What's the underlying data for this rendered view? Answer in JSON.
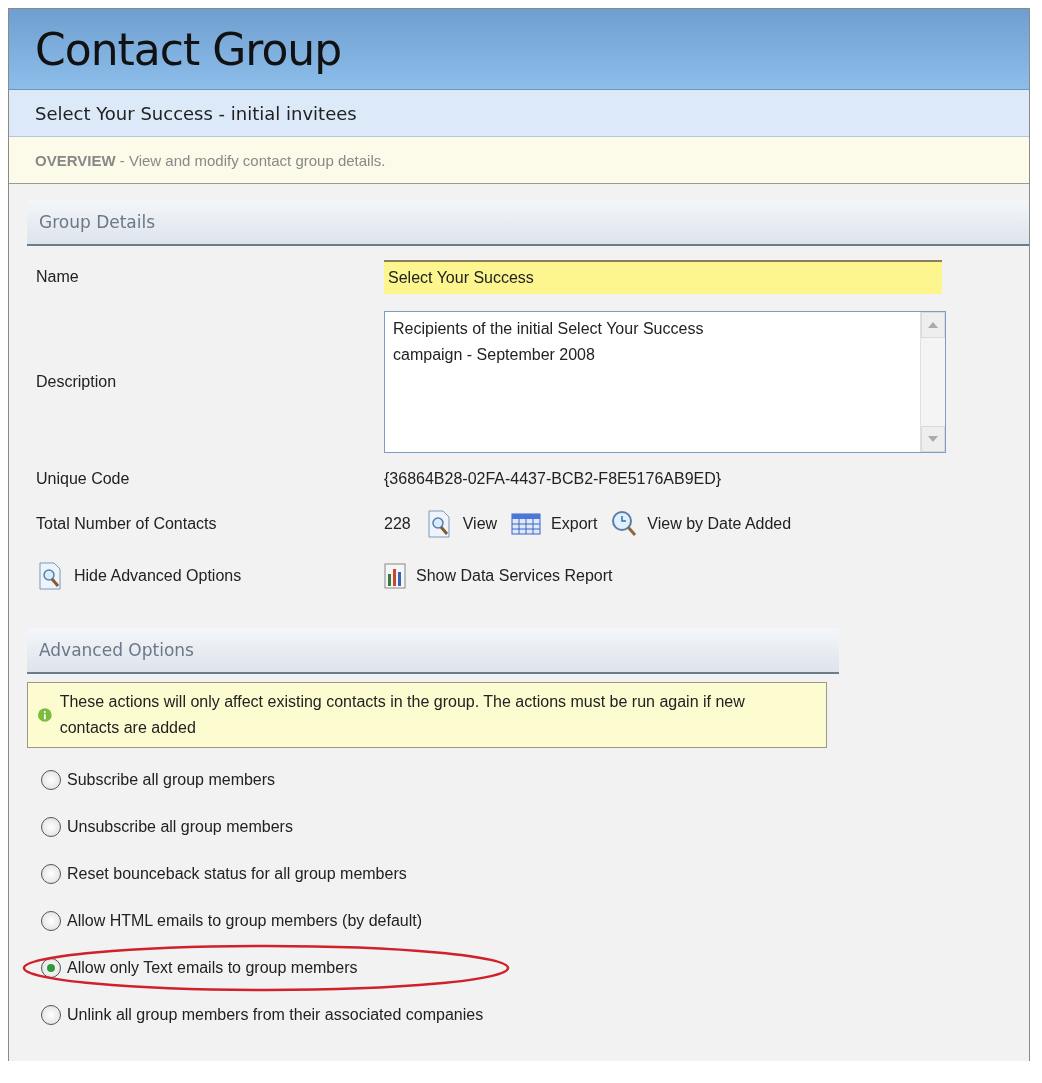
{
  "header": {
    "title": "Contact Group"
  },
  "subtitle": "Select Your Success - initial invitees",
  "overview": {
    "label": "OVERVIEW",
    "text": "- View and modify contact group details."
  },
  "group_details": {
    "heading": "Group Details",
    "name": {
      "label": "Name",
      "value": "Select Your Success"
    },
    "description": {
      "label": "Description",
      "value": "Recipients of the initial Select Your Success campaign - September 2008"
    },
    "unique_code": {
      "label": "Unique Code",
      "value": "{36864B28-02FA-4437-BCB2-F8E5176AB9ED}"
    },
    "total_contacts": {
      "label": "Total Number of Contacts",
      "value": "228",
      "links": [
        {
          "kind": "view",
          "label": "View"
        },
        {
          "kind": "export",
          "label": "Export"
        },
        {
          "kind": "date",
          "label": "View by Date Added"
        }
      ]
    },
    "actions": [
      {
        "kind": "view",
        "label": "Hide Advanced Options"
      },
      {
        "kind": "report",
        "label": "Show Data Services Report"
      }
    ]
  },
  "advanced_options": {
    "heading": "Advanced Options",
    "info": "These actions will only affect existing contacts in the group.  The actions must be run again if new contacts are added",
    "options": [
      {
        "label": "Subscribe all group members",
        "selected": false
      },
      {
        "label": "Unsubscribe all group members",
        "selected": false
      },
      {
        "label": "Reset bounceback status for all group members",
        "selected": false
      },
      {
        "label": "Allow HTML emails to group members (by default)",
        "selected": false
      },
      {
        "label": "Allow only Text emails to group members",
        "selected": true
      },
      {
        "label": "Unlink all group members from their associated companies",
        "selected": false
      }
    ]
  }
}
